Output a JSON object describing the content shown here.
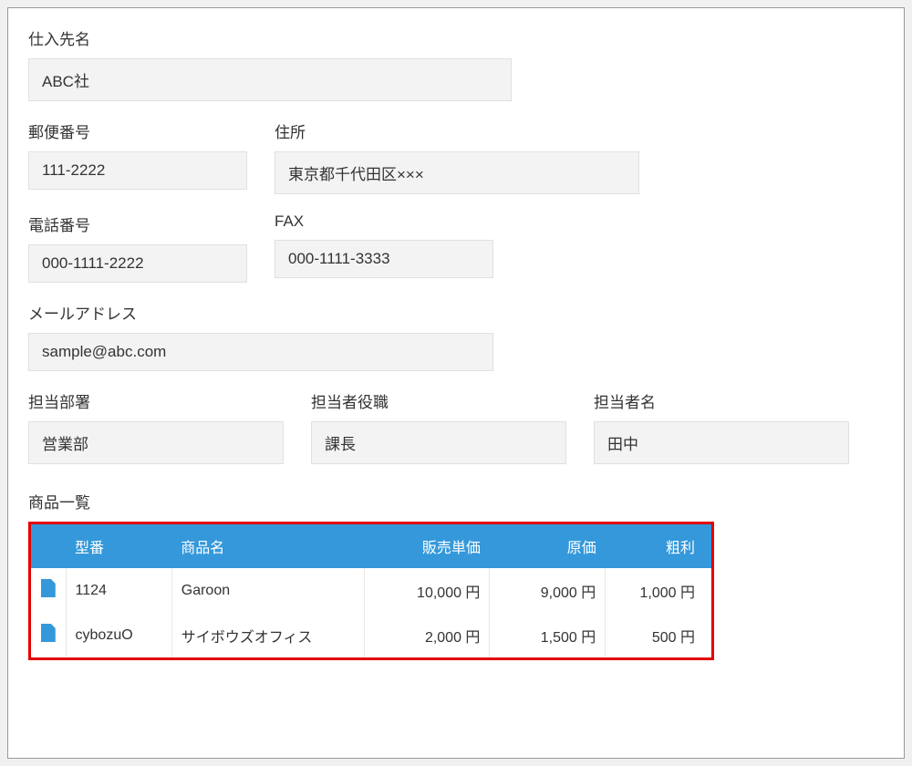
{
  "fields": {
    "supplier_label": "仕入先名",
    "supplier_value": "ABC社",
    "postal_label": "郵便番号",
    "postal_value": "111-2222",
    "address_label": "住所",
    "address_value": "東京都千代田区×××",
    "phone_label": "電話番号",
    "phone_value": "000-1111-2222",
    "fax_label": "FAX",
    "fax_value": "000-1111-3333",
    "email_label": "メールアドレス",
    "email_value": "sample@abc.com",
    "dept_label": "担当部署",
    "dept_value": "営業部",
    "title_label": "担当者役職",
    "title_value": "課長",
    "name_label": "担当者名",
    "name_value": "田中"
  },
  "products": {
    "section_label": "商品一覧",
    "headers": {
      "model": "型番",
      "name": "商品名",
      "price": "販売単価",
      "cost": "原価",
      "profit": "粗利"
    },
    "rows": [
      {
        "model": "1124",
        "name": "Garoon",
        "price": "10,000 円",
        "cost": "9,000 円",
        "profit": "1,000 円"
      },
      {
        "model": "cybozuO",
        "name": "サイボウズオフィス",
        "price": "2,000 円",
        "cost": "1,500 円",
        "profit": "500 円"
      }
    ]
  }
}
